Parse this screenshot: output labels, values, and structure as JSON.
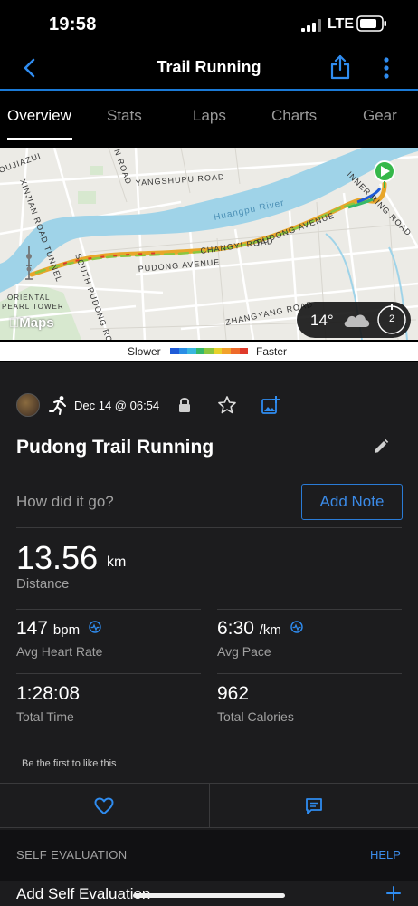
{
  "status_bar": {
    "time": "19:58",
    "network": "LTE"
  },
  "nav": {
    "title": "Trail Running"
  },
  "tabs": [
    {
      "label": "Overview",
      "active": true
    },
    {
      "label": "Stats",
      "active": false
    },
    {
      "label": "Laps",
      "active": false
    },
    {
      "label": "Charts",
      "active": false
    },
    {
      "label": "Gear",
      "active": false
    }
  ],
  "map": {
    "labels": {
      "yangshupu": "YANGSHUPU ROAD",
      "river": "Huangpu River",
      "changyi": "CHANGYI ROAD",
      "pudong_ave": "PUDONG AVENUE",
      "pudong_ave2": "PUDONG AVENUE",
      "xinjian": "XINJIAN ROAD TUNNEL",
      "south_pudong": "SOUTH PUDONG ROAD",
      "zhangyang": "ZHANGYANG ROAD",
      "inner_ring": "INNER RING ROAD",
      "oujiazui": "OUJIAZUI",
      "n_road": "N ROAD",
      "pearl_line1": "ORIENTAL",
      "pearl_line2": "PEARL TOWER"
    },
    "maps_brand": "Maps",
    "weather": {
      "temperature": "14°",
      "wind": "2"
    }
  },
  "legend": {
    "slower": "Slower",
    "faster": "Faster",
    "colors": [
      "#1f5bd8",
      "#2a8ee6",
      "#39b7e0",
      "#35b86a",
      "#8cc63f",
      "#e8d12a",
      "#f2a22b",
      "#ee6a2a",
      "#e03a2a"
    ]
  },
  "activity": {
    "date": "Dec 14 @ 06:54",
    "title": "Pudong Trail Running",
    "note_prompt": "How did it go?",
    "add_note_label": "Add Note",
    "distance": {
      "value": "13.56",
      "unit": "km",
      "label": "Distance"
    },
    "avg_heart_rate": {
      "value": "147",
      "unit": "bpm",
      "label": "Avg Heart Rate"
    },
    "avg_pace": {
      "value": "6:30",
      "unit": "/km",
      "label": "Avg Pace"
    },
    "total_time": {
      "value": "1:28:08",
      "label": "Total Time"
    },
    "total_calories": {
      "value": "962",
      "label": "Total Calories"
    },
    "likes_text": "Be the first to like this"
  },
  "self_evaluation": {
    "header": "SELF EVALUATION",
    "help": "HELP",
    "add_label": "Add Self Evaluation"
  }
}
